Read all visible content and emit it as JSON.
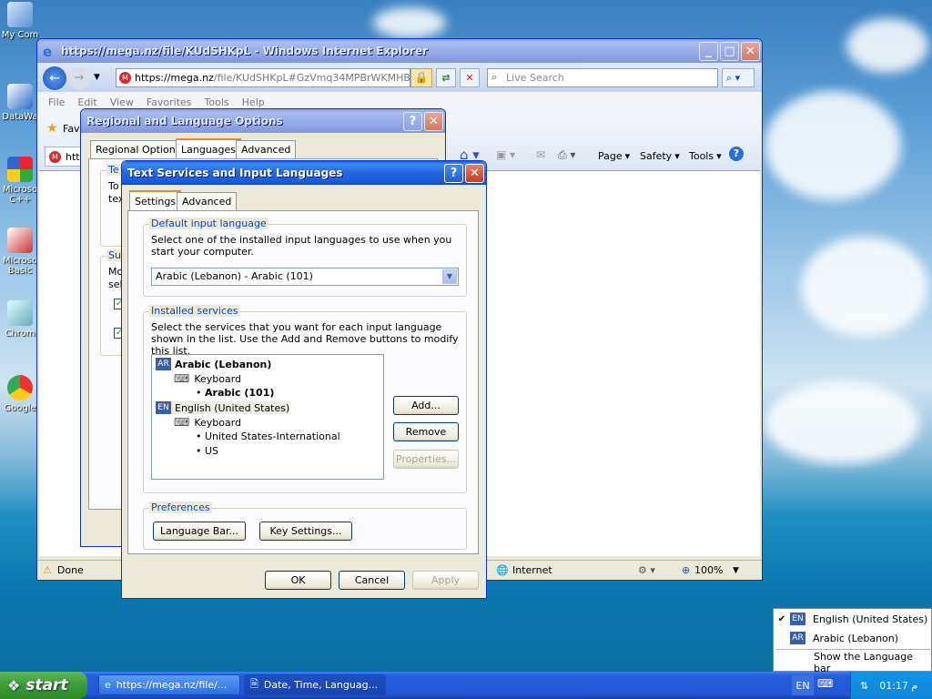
{
  "desktop": {
    "icons": [
      {
        "label": "My Com",
        "icon": "my-computer-icon"
      },
      {
        "label": "DataWa",
        "icon": "datawa-icon"
      },
      {
        "label": "Microso C++",
        "icon": "vcpp-icon"
      },
      {
        "label": "Microso Basic",
        "icon": "vb-icon"
      },
      {
        "label": "Chrom",
        "icon": "chrome-icon"
      },
      {
        "label": "Google",
        "icon": "google-icon"
      }
    ]
  },
  "ie": {
    "title": "https://mega.nz/file/KUdSHKpL - Windows Internet Explorer",
    "address_host": "https://mega.nz",
    "address_rest": "/file/KUdSHKpL#GzVmq34MPBrWKMHBN1",
    "search_placeholder": "Live Search",
    "menu": [
      "File",
      "Edit",
      "View",
      "Favorites",
      "Tools",
      "Help"
    ],
    "favorites_label": "Fav",
    "tab_label": "http",
    "cmd_page": "Page",
    "cmd_safety": "Safety",
    "cmd_tools": "Tools",
    "status_done": "Done",
    "status_zone": "Internet",
    "zoom": "100%"
  },
  "regional": {
    "title": "Regional and Language Options",
    "tabs": [
      "Regional Options",
      "Languages",
      "Advanced"
    ],
    "partial_text": [
      "Te",
      "To",
      "tex",
      "Su",
      "Mo",
      "sel"
    ]
  },
  "tsil": {
    "title": "Text Services and Input Languages",
    "tabs": [
      "Settings",
      "Advanced"
    ],
    "default_group": "Default input language",
    "default_desc": "Select one of the installed input languages to use when you start your computer.",
    "default_value": "Arabic (Lebanon) - Arabic (101)",
    "installed_group": "Installed services",
    "installed_desc": "Select the services that you want for each input language shown in the list. Use the Add and Remove buttons to modify this list.",
    "tree": {
      "lang1_code": "AR",
      "lang1": "Arabic (Lebanon)",
      "lang1_keyboard": "Keyboard",
      "lang1_layout": "Arabic (101)",
      "lang2_code": "EN",
      "lang2": "English (United States)",
      "lang2_keyboard": "Keyboard",
      "lang2_layout1": "United States-International",
      "lang2_layout2": "US"
    },
    "btn_add": "Add...",
    "btn_remove": "Remove",
    "btn_properties": "Properties...",
    "pref_group": "Preferences",
    "btn_langbar": "Language Bar...",
    "btn_keysettings": "Key Settings...",
    "btn_ok": "OK",
    "btn_cancel": "Cancel",
    "btn_apply": "Apply"
  },
  "lang_menu": {
    "items": [
      {
        "code": "EN",
        "label": "English (United States)",
        "checked": true
      },
      {
        "code": "AR",
        "label": "Arabic (Lebanon)",
        "checked": false
      }
    ],
    "show_bar": "Show the Language bar"
  },
  "taskbar": {
    "start": "start",
    "tasks": [
      "https://mega.nz/file/...",
      "Date, Time, Languag..."
    ],
    "lang": "EN",
    "clock": "01:17 م"
  }
}
